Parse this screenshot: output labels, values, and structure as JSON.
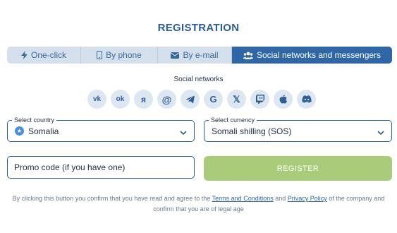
{
  "title": "REGISTRATION",
  "tabs": [
    {
      "label": "One-click",
      "icon": "lightning-icon"
    },
    {
      "label": "By phone",
      "icon": "phone-icon"
    },
    {
      "label": "By e-mail",
      "icon": "envelope-icon"
    },
    {
      "label": "Social networks and messengers",
      "icon": "users-icon",
      "active": true
    }
  ],
  "social": {
    "label": "Social networks",
    "icons": [
      "vk-icon",
      "odnoklassniki-icon",
      "yandex-icon",
      "mailru-icon",
      "telegram-icon",
      "google-icon",
      "x-icon",
      "twitch-icon",
      "apple-icon",
      "discord-icon"
    ],
    "glyphs": [
      "vk",
      "ok",
      "я",
      "@",
      "",
      "G",
      "𝕏",
      "",
      "",
      ""
    ]
  },
  "country": {
    "label": "Select country",
    "value": "Somalia"
  },
  "currency": {
    "label": "Select currency",
    "value": "Somali shilling (SOS)"
  },
  "promo": {
    "placeholder": "Promo code (if you have one)"
  },
  "register": {
    "label": "REGISTER"
  },
  "disclaimer": {
    "part1": "By clicking this button you confirm that you have read and agree to the ",
    "terms": "Terms and Conditions",
    "part2": " and ",
    "privacy": "Privacy Policy",
    "part3": " of the company and confirm that you are of legal age"
  },
  "colors": {
    "accent": "#2e66a6",
    "title": "#2b5f98",
    "register_bg": "#a9cc7a",
    "tab_bg": "#d4e0ec",
    "social_bg": "#dde7f1"
  }
}
